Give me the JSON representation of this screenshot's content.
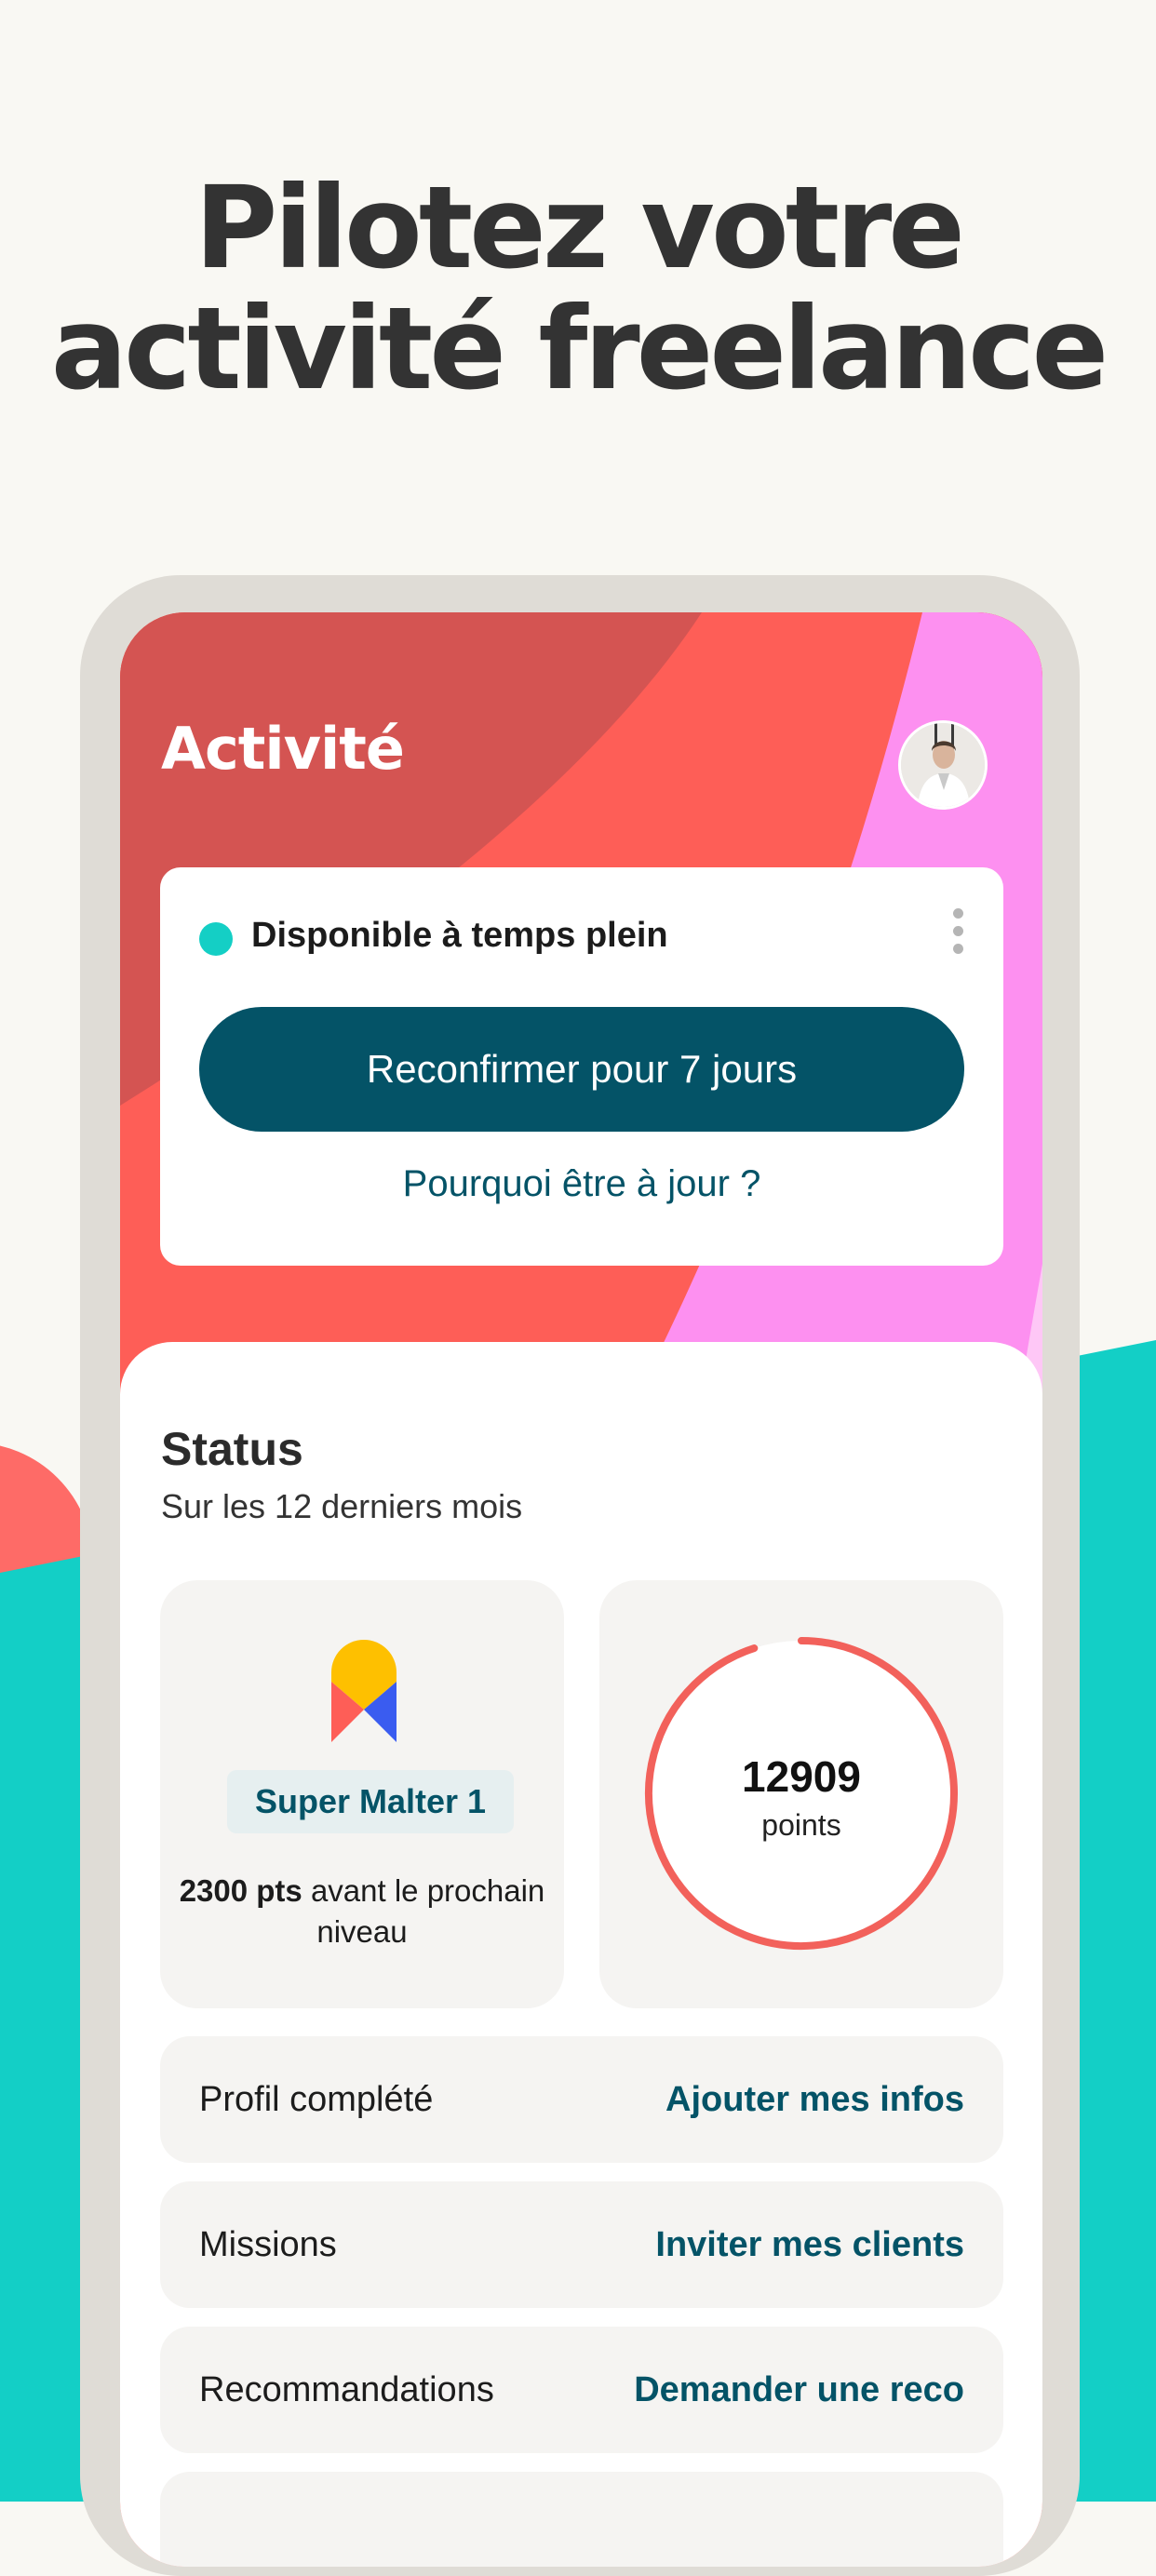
{
  "headline": {
    "line1": "Pilotez votre",
    "line2": "activité freelance"
  },
  "colors": {
    "accent": "#045367",
    "coral": "#fe5e57",
    "teal": "#14cfc5",
    "pink": "#fd90f0"
  },
  "screen": {
    "title": "Activité",
    "availability": {
      "status": "Disponible à temps plein",
      "confirm_button": "Reconfirmer pour 7 jours",
      "why_link": "Pourquoi être à jour ?"
    },
    "status": {
      "title": "Status",
      "subtitle": "Sur les 12 derniers mois",
      "level": "Super Malter 1",
      "next_level_points": "2300 pts",
      "next_level_text": "avant le prochain niveau",
      "points_value": "12909",
      "points_label": "points",
      "points_progress": 0.95
    },
    "rows": [
      {
        "label": "Profil complété",
        "action": "Ajouter mes infos"
      },
      {
        "label": "Missions",
        "action": "Inviter mes clients"
      },
      {
        "label": "Recommandations",
        "action": "Demander une reco"
      }
    ]
  }
}
